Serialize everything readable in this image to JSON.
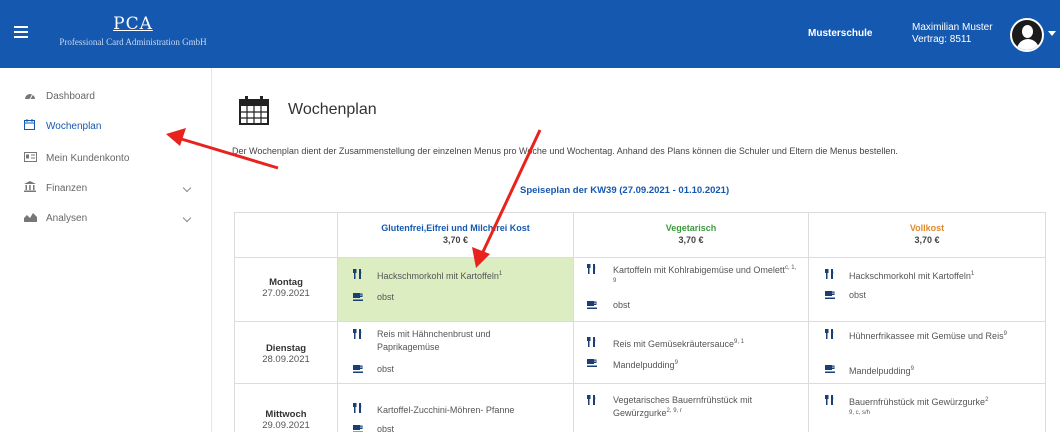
{
  "header": {
    "logo_title": "PCA",
    "logo_subtitle": "Professional Card Administration GmbH",
    "school": "Musterschule",
    "user_name": "Maximilian Muster",
    "contract": "Vertrag: 8511"
  },
  "sidebar": {
    "items": [
      {
        "label": "Dashboard"
      },
      {
        "label": "Wochenplan"
      },
      {
        "label": "Mein Kundenkonto"
      },
      {
        "label": "Finanzen"
      },
      {
        "label": "Analysen"
      }
    ]
  },
  "page": {
    "title": "Wochenplan",
    "description": "Der Wochenplan dient der Zusammenstellung der einzelnen Menus pro Woche und Wochentag. Anhand des Plans können die Schuler und Eltern die Menus bestellen.",
    "plan_link": "Speiseplan der KW39 (27.09.2021 - 01.10.2021)"
  },
  "table": {
    "columns": [
      {
        "title": "Glutenfrei,Eifrei und Milchfrei Kost",
        "price": "3,70 €",
        "color": "#1558b0"
      },
      {
        "title": "Vegetarisch",
        "price": "3,70 €",
        "color": "#3c9a3c"
      },
      {
        "title": "Vollkost",
        "price": "3,70 €",
        "color": "#e08a2e"
      }
    ],
    "days": [
      {
        "name": "Montag",
        "date": "27.09.2021",
        "menus": [
          {
            "main": "Hackschmorkohl mit Kartoffeln",
            "main_sup": "1",
            "dessert": "obst",
            "dessert_sup": ""
          },
          {
            "main": "Kartoffeln mit Kohlrabigemüse und Omelett",
            "main_sup": "c, 1, 9",
            "dessert": "obst",
            "dessert_sup": ""
          },
          {
            "main": "Hackschmorkohl mit Kartoffeln",
            "main_sup": "1",
            "dessert": "obst",
            "dessert_sup": ""
          }
        ]
      },
      {
        "name": "Dienstag",
        "date": "28.09.2021",
        "menus": [
          {
            "main": "Reis mit Hähnchenbrust und Paprikagemüse",
            "main_sup": "",
            "dessert": "obst",
            "dessert_sup": ""
          },
          {
            "main": "Reis mit Gemüsekräutersauce",
            "main_sup": "9, 1",
            "dessert": "Mandelpudding",
            "dessert_sup": "9"
          },
          {
            "main": "Hühnerfrikassee mit Gemüse und Reis",
            "main_sup": "9",
            "dessert": "Mandelpudding",
            "dessert_sup": "9"
          }
        ]
      },
      {
        "name": "Mittwoch",
        "date": "29.09.2021",
        "menus": [
          {
            "main": "Kartoffel-Zucchini-Möhren- Pfanne",
            "main_sup": "",
            "dessert": "obst",
            "dessert_sup": ""
          },
          {
            "main": "Vegetarisches Bauernfrühstück mit Gewürzgurke",
            "main_sup": "2, 9, r",
            "dessert": "",
            "dessert_sup": ""
          },
          {
            "main": "Bauernfrühstück mit Gewürzgurke",
            "main_sup": "2",
            "main_sup2": "9, c, s/h",
            "dessert": "",
            "dessert_sup": ""
          }
        ]
      }
    ]
  },
  "colors": {
    "header_bg": "#1558b0",
    "selected_cell": "#dcedc1",
    "annotation_arrow": "#e8231d"
  }
}
